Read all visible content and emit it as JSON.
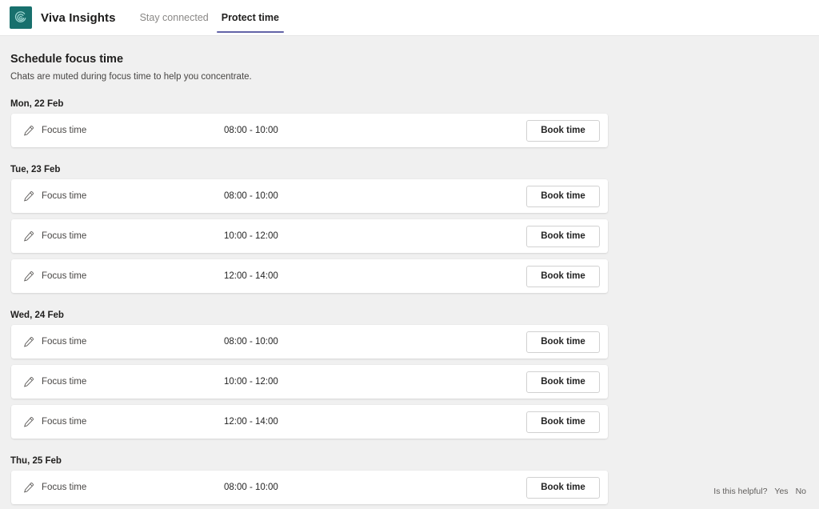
{
  "header": {
    "logo_icon": "viva-insights-spiral-icon",
    "brand": "Viva Insights",
    "brand_color": "#18706d",
    "accent_color": "#6264a7",
    "tabs": [
      {
        "label": "Stay connected",
        "active": false
      },
      {
        "label": "Protect time",
        "active": true
      }
    ]
  },
  "main": {
    "title": "Schedule focus time",
    "subtitle": "Chats are muted during focus time to help you concentrate.",
    "row_icon": "pencil-icon",
    "book_label": "Book time",
    "days": [
      {
        "label": "Mon, 22 Feb",
        "rows": [
          {
            "label": "Focus time",
            "time": "08:00 - 10:00",
            "action": "Book time"
          }
        ]
      },
      {
        "label": "Tue, 23 Feb",
        "rows": [
          {
            "label": "Focus time",
            "time": "08:00 - 10:00",
            "action": "Book time"
          },
          {
            "label": "Focus time",
            "time": "10:00 - 12:00",
            "action": "Book time"
          },
          {
            "label": "Focus time",
            "time": "12:00 - 14:00",
            "action": "Book time"
          }
        ]
      },
      {
        "label": "Wed, 24 Feb",
        "rows": [
          {
            "label": "Focus time",
            "time": "08:00 - 10:00",
            "action": "Book time"
          },
          {
            "label": "Focus time",
            "time": "10:00 - 12:00",
            "action": "Book time"
          },
          {
            "label": "Focus time",
            "time": "12:00 - 14:00",
            "action": "Book time"
          }
        ]
      },
      {
        "label": "Thu, 25 Feb",
        "rows": [
          {
            "label": "Focus time",
            "time": "08:00 - 10:00",
            "action": "Book time"
          }
        ]
      }
    ]
  },
  "feedback": {
    "prompt": "Is this helpful?",
    "yes": "Yes",
    "no": "No"
  }
}
